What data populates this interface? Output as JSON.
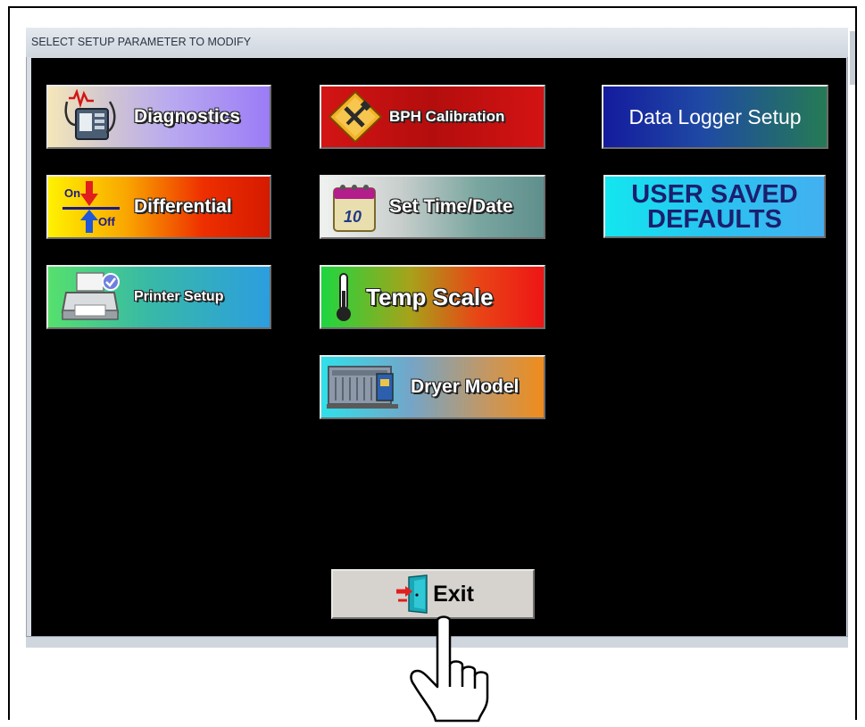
{
  "window": {
    "title": "SELECT SETUP PARAMETER TO MODIFY"
  },
  "buttons": {
    "diagnostics": "Diagnostics",
    "bph_calibration": "BPH Calibration",
    "data_logger_setup": "Data Logger Setup",
    "differential": "Differential",
    "set_time_date": "Set Time/Date",
    "user_saved_defaults_line1": "USER SAVED",
    "user_saved_defaults_line2": "DEFAULTS",
    "printer_setup": "Printer Setup",
    "temp_scale": "Temp Scale",
    "dryer_model": "Dryer Model",
    "exit": "Exit"
  },
  "icons": {
    "differential_on": "On",
    "differential_off": "Off",
    "calendar_day": "10"
  },
  "icon_names": [
    "diagnostics-icon",
    "calibration-tools-icon",
    "on-off-arrows-icon",
    "calendar-icon",
    "printer-icon",
    "thermometer-icon",
    "dryer-machine-icon",
    "exit-door-icon",
    "pointing-hand-cursor"
  ],
  "colors": {
    "client_background": "#000000",
    "exit_button": "#d6d3ce"
  }
}
